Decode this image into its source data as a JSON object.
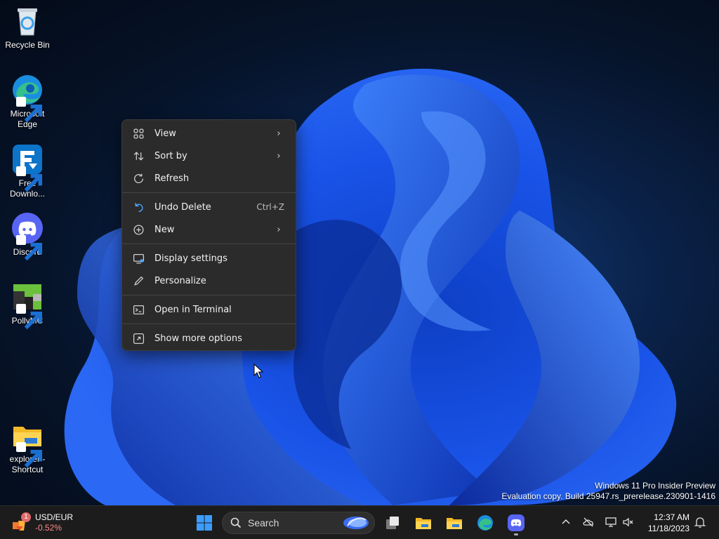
{
  "desktop_icons": [
    {
      "label": "Recycle Bin"
    },
    {
      "label": "Microsoft\nEdge"
    },
    {
      "label": "Free\nDownlo..."
    },
    {
      "label": "Discord"
    },
    {
      "label": "PollyMC"
    },
    {
      "label": "explorer -\nShortcut"
    }
  ],
  "context_menu": {
    "items": [
      {
        "label": "View",
        "icon": "view-grid-icon",
        "submenu": true
      },
      {
        "label": "Sort by",
        "icon": "sort-icon",
        "submenu": true
      },
      {
        "label": "Refresh",
        "icon": "refresh-icon"
      },
      {
        "label": "Undo Delete",
        "icon": "undo-icon",
        "shortcut": "Ctrl+Z"
      },
      {
        "label": "New",
        "icon": "new-plus-icon",
        "submenu": true
      },
      {
        "label": "Display settings",
        "icon": "display-icon"
      },
      {
        "label": "Personalize",
        "icon": "pen-icon"
      },
      {
        "label": "Open in Terminal",
        "icon": "terminal-icon"
      },
      {
        "label": "Show more options",
        "icon": "more-options-icon"
      }
    ]
  },
  "watermark": {
    "line1": "Windows 11 Pro Insider Preview",
    "line2": "Evaluation copy. Build 25947.rs_prerelease.230901-1416"
  },
  "taskbar": {
    "widget": {
      "title": "USD/EUR",
      "value": "-0.52%",
      "badge": "1"
    },
    "search_label": "Search",
    "clock": {
      "time": "12:37 AM",
      "date": "11/18/2023"
    }
  },
  "colors": {
    "accent_blue": "#2a6cf6",
    "menu_bg": "#2b2b2b",
    "taskbar_bg": "#1c1c1c",
    "negative": "#ff8a8a"
  }
}
